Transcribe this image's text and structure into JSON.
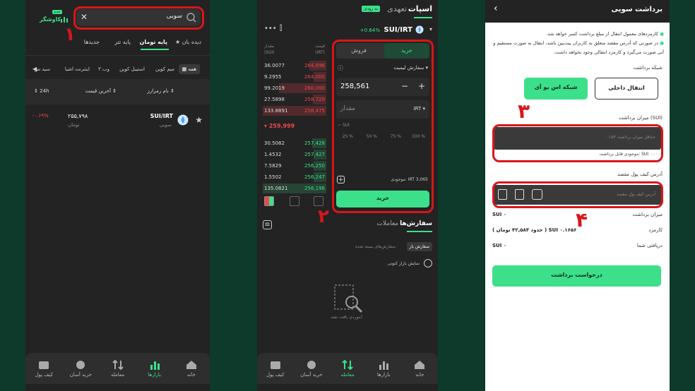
{
  "colors": {
    "accent": "#3ce08a",
    "red": "#f0454d",
    "annotation": "#d8161a",
    "bg": "#0d3a2a"
  },
  "panel1": {
    "search_value": "سویی",
    "logo_text": "کاوشگر",
    "logo_badge": "جدید",
    "tabs": [
      "دیده بان",
      "پایه تومان",
      "پایه تتر",
      "جدیدها"
    ],
    "chips": [
      "همه",
      "میم کوین",
      "استیبل کوین",
      "وب ۳",
      "اینترنت اشیا",
      "سید س"
    ],
    "col_name": "نام رمزارز",
    "col_price": "آخرین قیمت",
    "col_24h": "24h",
    "coin_pair": "SUI/IRT",
    "coin_name": "سویی",
    "coin_price": "۲۵۵,۷۹۸",
    "coin_unit": "تومان",
    "coin_change": "-۰.۶۹%",
    "nav": [
      "خانه",
      "بازارها",
      "معامله",
      "خرید آسان",
      "کیف پول"
    ],
    "annotation": "۱"
  },
  "panel2": {
    "tab_spot": "اسپات",
    "tab_margin": "تعهدی",
    "soon_badge": "به زودی",
    "pair": "SUI/IRT",
    "change": "+0.64%",
    "col_price": "قیمت",
    "col_price_unit": "(IRT)",
    "col_amount": "مقدار",
    "col_amount_unit": "(SUI)",
    "asks": [
      {
        "amount": "36.0077",
        "price": "264,896"
      },
      {
        "amount": "9.2955",
        "price": "264,000"
      },
      {
        "amount": "99.2019",
        "price": "260,000"
      },
      {
        "amount": "27.5898",
        "price": "258,720"
      },
      {
        "amount": "133.8891",
        "price": "258,475"
      }
    ],
    "last_price": "259,999",
    "bids": [
      {
        "amount": "30.5082",
        "price": "257,428"
      },
      {
        "amount": "1.4532",
        "price": "257,427"
      },
      {
        "amount": "7.5829",
        "price": "256,250"
      },
      {
        "amount": "1.5502",
        "price": "256,247"
      },
      {
        "amount": "135.0821",
        "price": "256,196"
      }
    ],
    "buy_tab": "خرید",
    "sell_tab": "فروش",
    "order_type": "سفارش لیمیت",
    "price_value": "258,561",
    "amount_placeholder": "مقدار",
    "currency": "IRT",
    "total_label": "SUI",
    "pcts": [
      "100 %",
      "75 %",
      "50 %",
      "25 %"
    ],
    "balance_label": "موجودی:",
    "balance_value": "IRT 3,065",
    "buy_button": "خرید",
    "orders_tab": "سفارش‌ها",
    "trades_tab": "معاملات",
    "open_orders": "سفارش باز",
    "closed_orders": "سفارش‌های بسته شده",
    "show_current": "نمایش بازار کنونی",
    "empty": "موردی یافت نشد!",
    "nav": [
      "خانه",
      "بازارها",
      "معامله",
      "خرید آسان",
      "کیف پول"
    ],
    "annotation": "۲"
  },
  "panel3": {
    "title": "برداشت سویی",
    "notes": [
      "کارمزدهای معمول انتقال از مبلغ برداشت کسر خواهد شد.",
      "در صورتی که آدرس مقصد متعلق به کاربران بیت‌پین باشد، انتقال به صورت مستقیم و آنی صورت می‌گیرد و کارمزد انتقالی وجود نخواهد داشت."
    ],
    "network_label": "شبکه برداشت",
    "net_internal": "انتقال داخلی",
    "net_sui": "شبکه اس یو آی",
    "amount_label": "میزان برداشت (SUI)",
    "amount_placeholder": "حداقل میزان برداشت ۰.۱۵۳",
    "available": "موجودی قابل برداشت: SUI ۰.۰۰۰۰",
    "address_label": "آدرس کیف پول مقصد",
    "address_placeholder": "آدرس کیف پول مقصد",
    "summary": [
      {
        "label": "میزان برداشت",
        "value": "SUI ۰"
      },
      {
        "label": "کارمزد",
        "value": "( حدود ۴۲,۵۸۴ تومان ) SUI ۰.۱۶۵۶"
      },
      {
        "label": "دریافتی شما",
        "value": "SUI ۰"
      }
    ],
    "submit": "درخواست برداشت",
    "annotation3": "۳",
    "annotation4": "۴"
  }
}
